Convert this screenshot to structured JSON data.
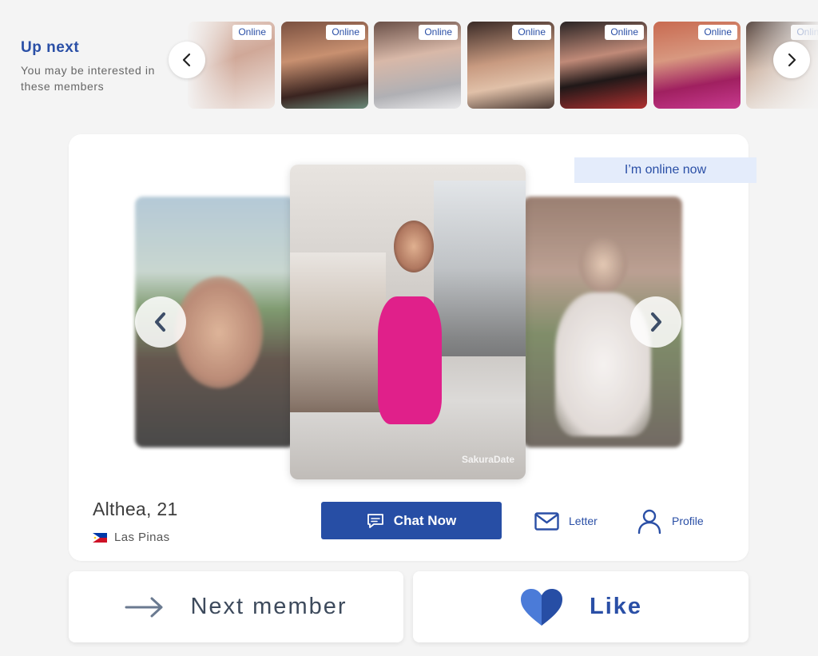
{
  "upnext": {
    "title": "Up next",
    "subtitle": "You may be interested in these members",
    "badge": "Online",
    "thumbs": [
      {
        "badge": "Online",
        "bg": "#d8b8a8"
      },
      {
        "badge": "Online",
        "bg": "#8a5a48"
      },
      {
        "badge": "Online",
        "bg": "#b0a8a4"
      },
      {
        "badge": "Online",
        "bg": "#5a4038"
      },
      {
        "badge": "Online",
        "bg": "#3a2a2a"
      },
      {
        "badge": "Online",
        "bg": "#b84a6a"
      },
      {
        "badge": "Online",
        "bg": "#a89890"
      }
    ],
    "prev_icon": "chevron-left-icon",
    "next_icon": "chevron-right-icon"
  },
  "profile": {
    "online_label": "I’m online now",
    "name": "Althea, 21",
    "location": "Las Pinas",
    "flag": "philippines-flag-icon",
    "watermark": "SakuraDate"
  },
  "actions": {
    "chat": "Chat Now",
    "letter": "Letter",
    "profile": "Profile"
  },
  "bottom": {
    "next": "Next member",
    "like": "Like"
  },
  "colors": {
    "accent": "#274ea5",
    "online_bg": "#e4ecfb",
    "heart_dark": "#274ea5",
    "heart_light": "#4b7bd8"
  }
}
